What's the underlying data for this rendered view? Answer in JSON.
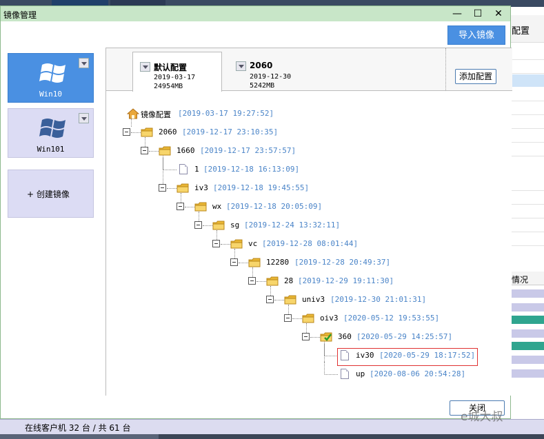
{
  "dialog": {
    "title": "镜像管理",
    "import_label": "导入镜像",
    "add_config_label": "添加配置",
    "close_label": "关闭",
    "window_controls": {
      "minimize": "—",
      "maximize": "☐",
      "close": "✕"
    }
  },
  "images": [
    {
      "name": "Win10",
      "selected": true
    },
    {
      "name": "Win101",
      "selected": false
    }
  ],
  "create_image_label": "+ 创建镜像",
  "tabs": [
    {
      "title": "默认配置",
      "date": "2019-03-17",
      "size": "24954MB",
      "active": true
    },
    {
      "title": "2060",
      "date": "2019-12-30",
      "size": "5242MB",
      "active": false
    }
  ],
  "tree": {
    "root": {
      "label": "镜像配置",
      "timestamp": "[2019-03-17 19:27:52]",
      "icon": "home-icon"
    },
    "nodes": [
      {
        "label": "2060",
        "timestamp": "[2019-12-17 23:10:35]",
        "icon": "folder-icon"
      },
      {
        "label": "1660",
        "timestamp": "[2019-12-17 23:57:57]",
        "icon": "folder-icon"
      },
      {
        "label": "1",
        "timestamp": "[2019-12-18 16:13:09]",
        "icon": "file-icon"
      },
      {
        "label": "iv3",
        "timestamp": "[2019-12-18 19:45:55]",
        "icon": "folder-icon"
      },
      {
        "label": "wx",
        "timestamp": "[2019-12-18 20:05:09]",
        "icon": "folder-icon"
      },
      {
        "label": "sg",
        "timestamp": "[2019-12-24 13:32:11]",
        "icon": "folder-icon"
      },
      {
        "label": "vc",
        "timestamp": "[2019-12-28 08:01:44]",
        "icon": "folder-icon"
      },
      {
        "label": "12280",
        "timestamp": "[2019-12-28 20:49:37]",
        "icon": "folder-icon"
      },
      {
        "label": "28",
        "timestamp": "[2019-12-29 19:11:30]",
        "icon": "folder-icon"
      },
      {
        "label": "univ3",
        "timestamp": "[2019-12-30 21:01:31]",
        "icon": "folder-icon"
      },
      {
        "label": "oiv3",
        "timestamp": "[2020-05-12 19:53:55]",
        "icon": "folder-icon"
      },
      {
        "label": "360",
        "timestamp": "[2020-05-29 14:25:57]",
        "icon": "folder-check-icon"
      },
      {
        "label": "iv30",
        "timestamp": "[2020-05-29 18:17:52]",
        "icon": "file-icon",
        "highlighted": true
      },
      {
        "label": "up",
        "timestamp": "[2020-08-06 20:54:28]",
        "icon": "file-icon"
      }
    ]
  },
  "status_bar": {
    "text": "在线客户机 32 台 / 共 61 台"
  },
  "background": {
    "header_text": "配置",
    "column_text": "情况"
  },
  "watermark": "e城大叔",
  "colors": {
    "accent": "#4a90e2",
    "titlebar": "#c8e6c8",
    "timestamp": "#4a84c8",
    "highlight": "#e03030"
  }
}
